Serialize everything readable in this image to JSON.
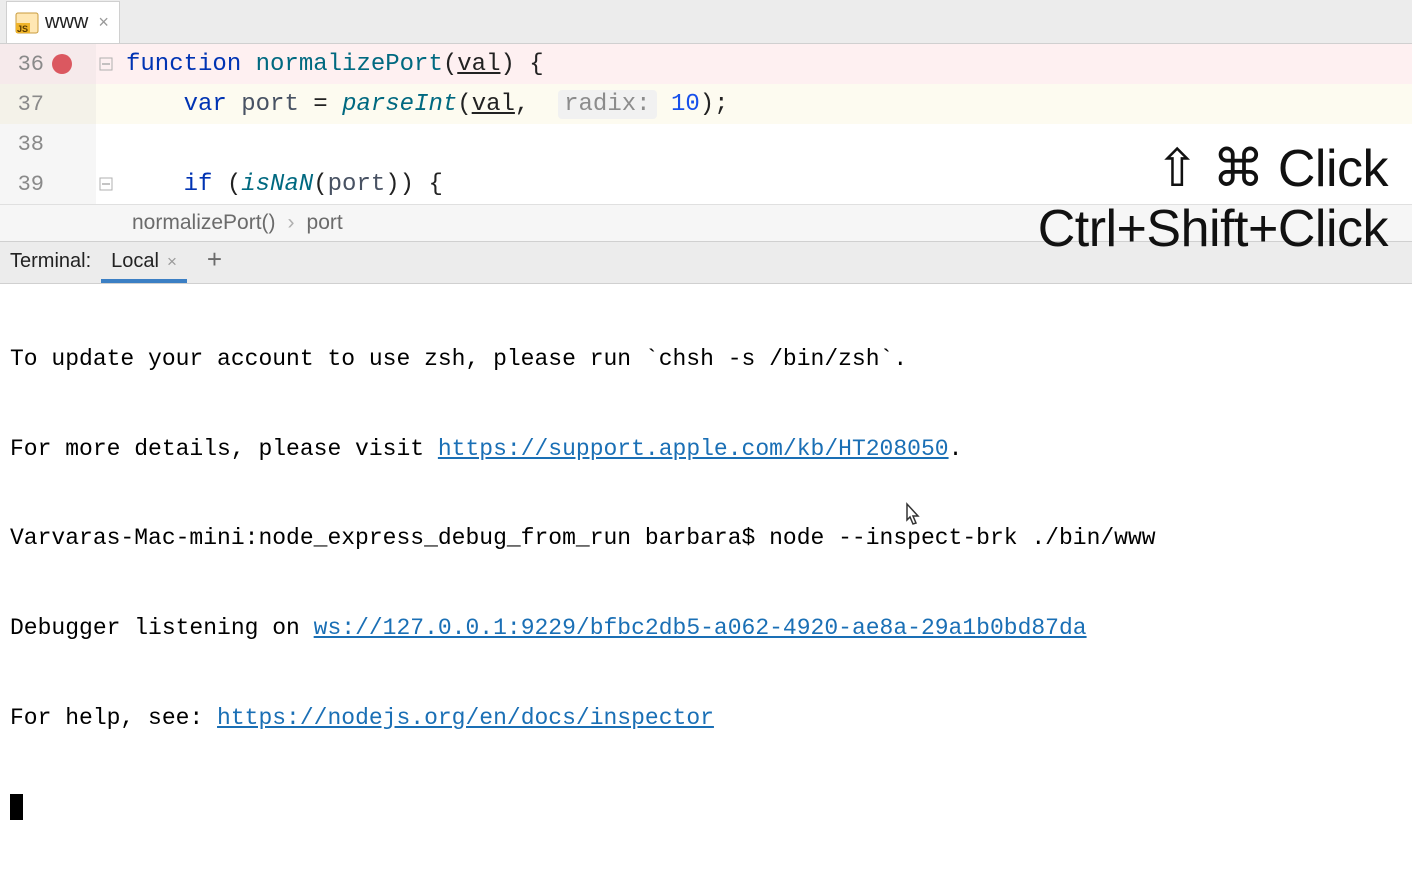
{
  "tab": {
    "filename": "www",
    "filetype": "JS"
  },
  "code": {
    "lines": [
      {
        "num": "36",
        "breakpoint": true,
        "fold": "minus",
        "tokens": [
          {
            "t": "function",
            "c": "kw"
          },
          {
            "t": " ",
            "c": ""
          },
          {
            "t": "normalizePort",
            "c": "fn"
          },
          {
            "t": "(",
            "c": "punc"
          },
          {
            "t": "val",
            "c": "param-u"
          },
          {
            "t": ") {",
            "c": "punc"
          }
        ]
      },
      {
        "num": "37",
        "breakpoint": false,
        "fold": "",
        "tokens": [
          {
            "t": "    ",
            "c": ""
          },
          {
            "t": "var",
            "c": "kw"
          },
          {
            "t": " ",
            "c": ""
          },
          {
            "t": "port",
            "c": "ident"
          },
          {
            "t": " = ",
            "c": "punc"
          },
          {
            "t": "parseInt",
            "c": "fn fn-italic"
          },
          {
            "t": "(",
            "c": "punc"
          },
          {
            "t": "val",
            "c": "param-u"
          },
          {
            "t": ",  ",
            "c": "punc"
          },
          {
            "t": "radix:",
            "c": "hint"
          },
          {
            "t": " ",
            "c": ""
          },
          {
            "t": "10",
            "c": "num"
          },
          {
            "t": ");",
            "c": "punc"
          }
        ]
      },
      {
        "num": "38",
        "breakpoint": false,
        "fold": "",
        "tokens": []
      },
      {
        "num": "39",
        "breakpoint": false,
        "fold": "minus",
        "tokens": [
          {
            "t": "    ",
            "c": ""
          },
          {
            "t": "if",
            "c": "kw"
          },
          {
            "t": " (",
            "c": "punc"
          },
          {
            "t": "isNaN",
            "c": "fn fn-italic"
          },
          {
            "t": "(",
            "c": "punc"
          },
          {
            "t": "port",
            "c": "ident"
          },
          {
            "t": ")) {",
            "c": "punc"
          }
        ]
      }
    ]
  },
  "breadcrumbs": {
    "item1": "normalizePort()",
    "sep": "›",
    "item2": "port"
  },
  "terminal": {
    "label": "Terminal:",
    "tab_name": "Local",
    "line1_a": "To update your account to use zsh, please run `chsh -s /bin/zsh`.",
    "line2_a": "For more details, please visit ",
    "line2_link": "https://support.apple.com/kb/HT208050",
    "line2_b": ".",
    "line3": "Varvaras-Mac-mini:node_express_debug_from_run barbara$ node --inspect-brk ./bin/www",
    "line4_a": "Debugger listening on ",
    "line4_link": "ws://127.0.0.1:9229/bfbc2db5-a062-4920-ae8a-29a1b0bd87da",
    "line5_a": "For help, see: ",
    "line5_link": "https://nodejs.org/en/docs/inspector"
  },
  "overlay": {
    "line1": "⇧ ⌘ Click",
    "line2": "Ctrl+Shift+Click"
  }
}
